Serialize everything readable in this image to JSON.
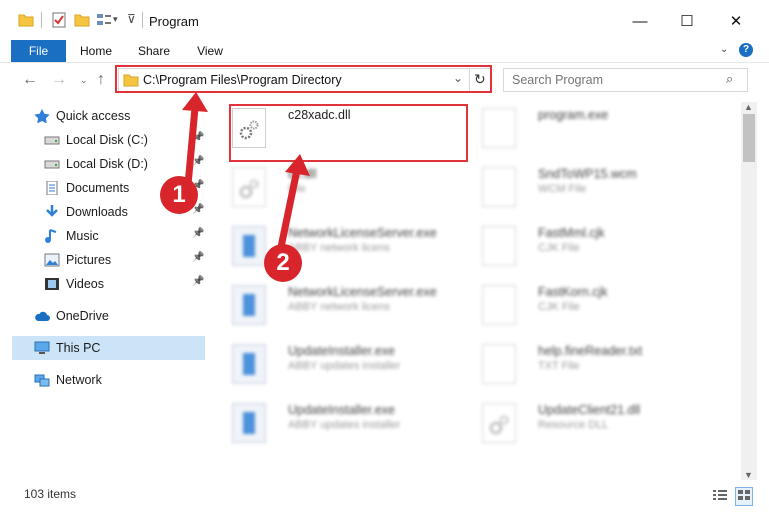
{
  "window": {
    "title": "Program",
    "minimize_glyph": "—",
    "maximize_glyph": "☐",
    "close_glyph": "✕"
  },
  "ribbon": {
    "tabs": [
      "File",
      "Home",
      "Share",
      "View"
    ],
    "help_glyph": "?"
  },
  "nav": {
    "back_glyph": "←",
    "forward_glyph": "→",
    "up_glyph": "↑",
    "address": "C:\\Program Files\\Program Directory",
    "refresh_glyph": "↻",
    "search_placeholder": "Search Program"
  },
  "sidebar": {
    "quick_access_label": "Quick access",
    "items": [
      {
        "label": "Local Disk (C:)",
        "icon": "drive-icon",
        "pinned": true
      },
      {
        "label": "Local Disk (D:)",
        "icon": "drive-icon",
        "pinned": true
      },
      {
        "label": "Documents",
        "icon": "documents-icon",
        "pinned": true
      },
      {
        "label": "Downloads",
        "icon": "downloads-icon",
        "pinned": true
      },
      {
        "label": "Music",
        "icon": "music-icon",
        "pinned": true
      },
      {
        "label": "Pictures",
        "icon": "pictures-icon",
        "pinned": true
      },
      {
        "label": "Videos",
        "icon": "videos-icon",
        "pinned": true
      }
    ],
    "onedrive_label": "OneDrive",
    "thispc_label": "This PC",
    "network_label": "Network"
  },
  "files": {
    "highlighted": {
      "name": "c28xadc.dll"
    },
    "col1": [
      {
        "name": "c28xadc.dll",
        "sub": ""
      },
      {
        "name": "dll.dll",
        "sub": "File"
      },
      {
        "name": "NetworkLicenseServer.exe",
        "sub": "ABBY network licens"
      },
      {
        "name": "NetworkLicenseServer.exe",
        "sub": "ABBY network licens"
      },
      {
        "name": "UpdateInstaller.exe",
        "sub": "ABBY updates installer"
      },
      {
        "name": "UpdateInstaller.exe",
        "sub": "ABBY updates installer"
      }
    ],
    "col2": [
      {
        "name": "program.exe",
        "sub": ""
      },
      {
        "name": "SndToWP15.wcm",
        "sub": "WCM File"
      },
      {
        "name": "FastMml.cjk",
        "sub": "CJK File"
      },
      {
        "name": "FastKorn.cjk",
        "sub": "CJK File"
      },
      {
        "name": "help.fineReader.txt",
        "sub": "TXT File"
      },
      {
        "name": "UpdateClient21.dll",
        "sub": "Resource DLL"
      }
    ]
  },
  "status": {
    "count": "103 items"
  },
  "annotations": {
    "badge1": "1",
    "badge2": "2",
    "color": "#d8252b"
  },
  "colors": {
    "accent": "#1a6fc2",
    "selected": "#cce4f7"
  }
}
